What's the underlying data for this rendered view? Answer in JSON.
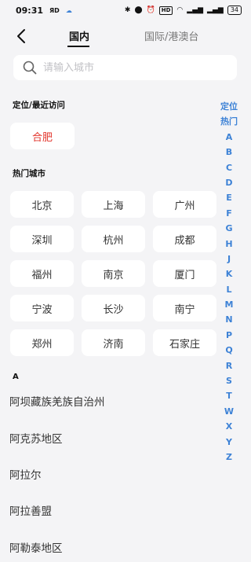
{
  "status_bar": {
    "time": "09:31",
    "left_icons": [
      "sim-icon",
      "cloud-icon"
    ],
    "battery": "34",
    "hd_label": "HD"
  },
  "nav": {
    "tabs": [
      {
        "label": "国内",
        "active": true
      },
      {
        "label": "国际/港澳台",
        "active": false
      }
    ]
  },
  "search": {
    "placeholder": "请输入城市",
    "value": ""
  },
  "recent": {
    "title": "定位/最近访问",
    "items": [
      "合肥"
    ],
    "accent_color": "#e2342b"
  },
  "hot": {
    "title": "热门城市",
    "cities": [
      "北京",
      "上海",
      "广州",
      "深圳",
      "杭州",
      "成都",
      "福州",
      "南京",
      "厦门",
      "宁波",
      "长沙",
      "南宁",
      "郑州",
      "济南",
      "石家庄"
    ]
  },
  "index": {
    "items": [
      "定位",
      "热门",
      "A",
      "B",
      "C",
      "D",
      "E",
      "F",
      "G",
      "H",
      "J",
      "K",
      "L",
      "M",
      "N",
      "P",
      "Q",
      "R",
      "S",
      "T",
      "W",
      "X",
      "Y",
      "Z"
    ],
    "color": "#3d82d6"
  },
  "group": {
    "letter": "A",
    "cities": [
      "阿坝藏族羌族自治州",
      "阿克苏地区",
      "阿拉尔",
      "阿拉善盟",
      "阿勒泰地区"
    ]
  }
}
